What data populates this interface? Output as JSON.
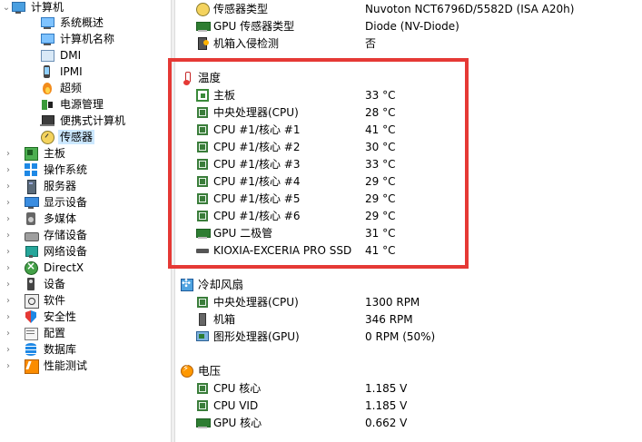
{
  "tree": {
    "computer": "计算机",
    "computer_children": [
      "系统概述",
      "计算机名称",
      "DMI",
      "IPMI",
      "超频",
      "电源管理",
      "便携式计算机",
      "传感器"
    ],
    "categories": [
      "主板",
      "操作系统",
      "服务器",
      "显示设备",
      "多媒体",
      "存储设备",
      "网络设备",
      "DirectX",
      "设备",
      "软件",
      "安全性",
      "配置",
      "数据库",
      "性能测试"
    ]
  },
  "props": {
    "sensor_type_label": "传感器类型",
    "sensor_type_value": "Nuvoton NCT6796D/5582D  (ISA A20h)",
    "gpu_sensor_type_label": "GPU 传感器类型",
    "gpu_sensor_type_value": "Diode  (NV-Diode)",
    "intrusion_label": "机箱入侵检测",
    "intrusion_value": "否"
  },
  "temperature": {
    "title": "温度",
    "rows": [
      {
        "label": "主板",
        "value": "33 °C"
      },
      {
        "label": "中央处理器(CPU)",
        "value": "28 °C"
      },
      {
        "label": "CPU #1/核心 #1",
        "value": "41 °C"
      },
      {
        "label": "CPU #1/核心 #2",
        "value": "30 °C"
      },
      {
        "label": "CPU #1/核心 #3",
        "value": "33 °C"
      },
      {
        "label": "CPU #1/核心 #4",
        "value": "29 °C"
      },
      {
        "label": "CPU #1/核心 #5",
        "value": "29 °C"
      },
      {
        "label": "CPU #1/核心 #6",
        "value": "29 °C"
      },
      {
        "label": "GPU 二极管",
        "value": "31 °C"
      },
      {
        "label": "KIOXIA-EXCERIA PRO SSD",
        "value": "41 °C"
      }
    ]
  },
  "fans": {
    "title": "冷却风扇",
    "rows": [
      {
        "label": "中央处理器(CPU)",
        "value": "1300 RPM"
      },
      {
        "label": "机箱",
        "value": "346 RPM"
      },
      {
        "label": "图形处理器(GPU)",
        "value": "0 RPM  (50%)"
      }
    ]
  },
  "voltage": {
    "title": "电压",
    "rows": [
      {
        "label": "CPU 核心",
        "value": "1.185 V"
      },
      {
        "label": "CPU VID",
        "value": "1.185 V"
      },
      {
        "label": "GPU 核心",
        "value": "0.662 V"
      }
    ]
  },
  "colors": {
    "highlight_border": "#e53935",
    "selected_bg": "#cce8ff"
  }
}
